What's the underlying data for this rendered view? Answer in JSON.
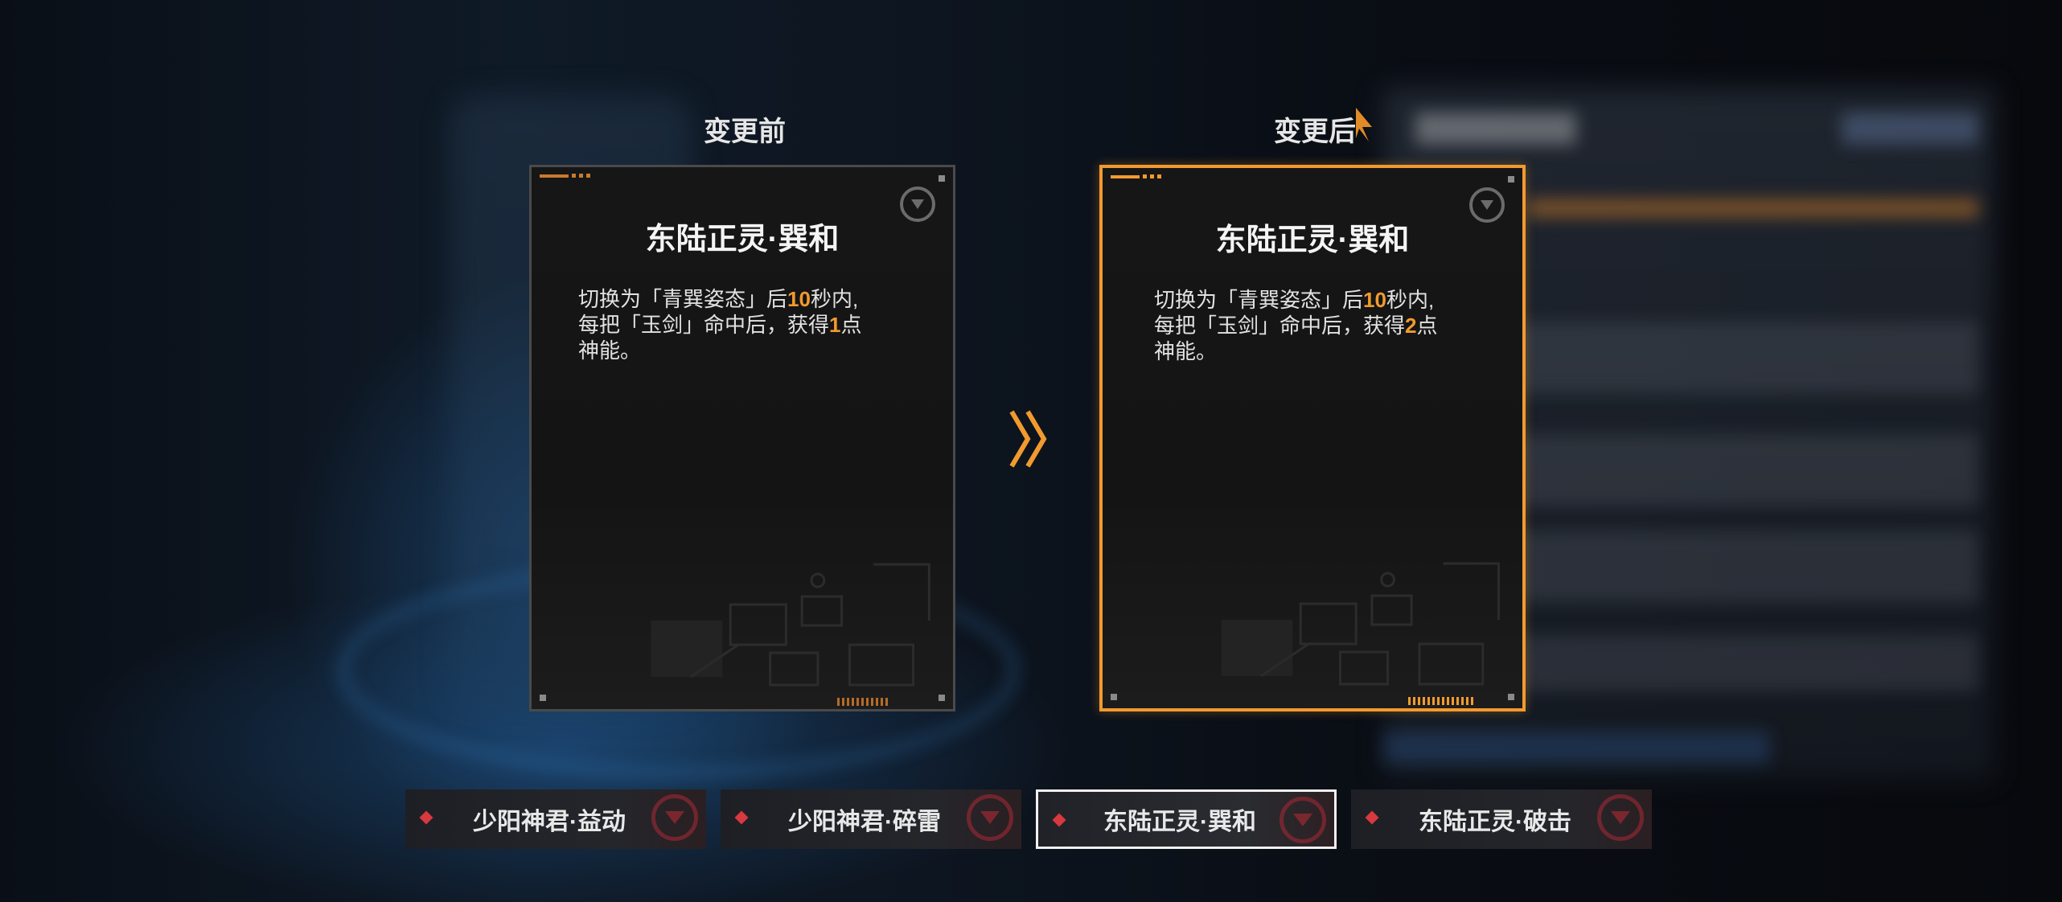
{
  "comparison": {
    "before_label": "变更前",
    "after_label": "变更后"
  },
  "before_card": {
    "name": "东陆正灵·巽和",
    "desc_part1": "切换为「青巽姿态」后",
    "desc_value1": "10",
    "desc_part2": "秒内,",
    "desc_part3": "每把「玉剑」命中后，获得",
    "desc_value2": "1",
    "desc_part4": "点",
    "desc_part5": "神能。"
  },
  "after_card": {
    "name": "东陆正灵·巽和",
    "desc_part1": "切换为「青巽姿态」后",
    "desc_value1": "10",
    "desc_part2": "秒内,",
    "desc_part3": "每把「玉剑」命中后，获得",
    "desc_value2": "2",
    "desc_part4": "点",
    "desc_part5": "神能。"
  },
  "tabs": [
    {
      "label": "少阳神君·益动",
      "active": false
    },
    {
      "label": "少阳神君·碎雷",
      "active": false
    },
    {
      "label": "东陆正灵·巽和",
      "active": true
    },
    {
      "label": "东陆正灵·破击",
      "active": false
    }
  ],
  "colors": {
    "accent": "#f29a2e",
    "tab_diamond": "#d8383f",
    "card_bg": "#151515"
  },
  "icons": {
    "card_emblem": "faction-emblem-icon",
    "transition": "double-chevron-right-icon",
    "tab_marker": "red-diamond-icon"
  }
}
